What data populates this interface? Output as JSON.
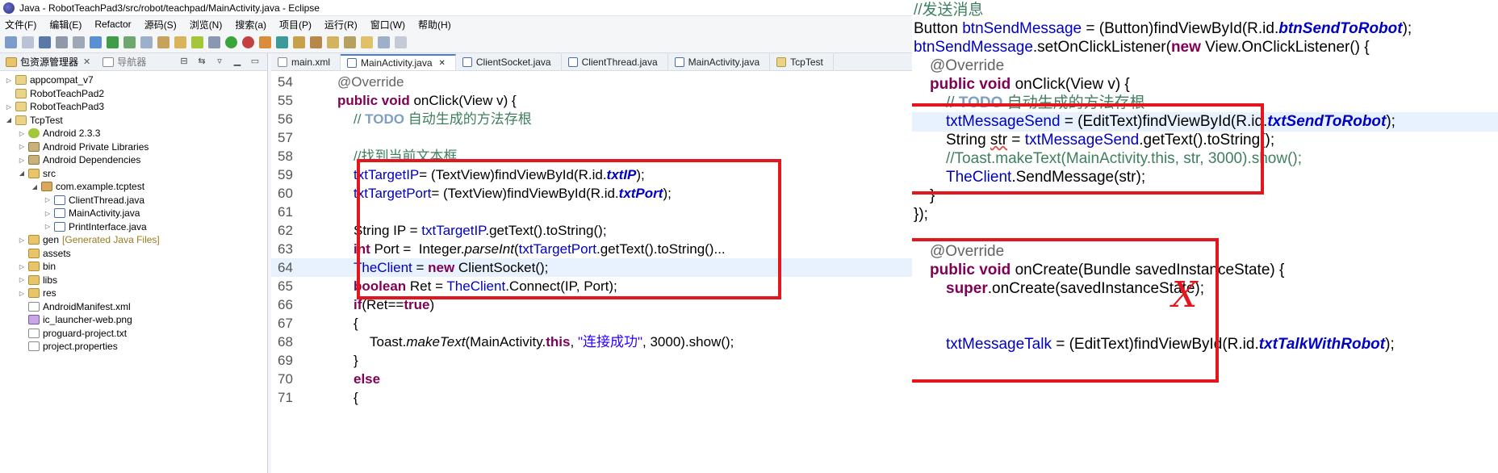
{
  "window": {
    "title": "Java  -  RobotTeachPad3/src/robot/teachpad/MainActivity.java  -  Eclipse"
  },
  "menu": [
    "文件(F)",
    "编辑(E)",
    "Refactor",
    "源码(S)",
    "浏览(N)",
    "搜索(a)",
    "项目(P)",
    "运行(R)",
    "窗口(W)",
    "帮助(H)"
  ],
  "explorer": {
    "tab_label": "包资源管理器",
    "tab2_label": "导航器",
    "tree": [
      {
        "label": "appcompat_v7",
        "depth": 0,
        "twisty": "▷",
        "icon": "project-icon"
      },
      {
        "label": "RobotTeachPad2",
        "depth": 0,
        "twisty": "",
        "icon": "project-icon"
      },
      {
        "label": "RobotTeachPad3",
        "depth": 0,
        "twisty": "▷",
        "icon": "project-icon"
      },
      {
        "label": "TcpTest",
        "depth": 0,
        "twisty": "◢",
        "icon": "project-icon"
      },
      {
        "label": "Android 2.3.3",
        "depth": 1,
        "twisty": "▷",
        "icon": "android-icon"
      },
      {
        "label": "Android Private Libraries",
        "depth": 1,
        "twisty": "▷",
        "icon": "library-icon"
      },
      {
        "label": "Android Dependencies",
        "depth": 1,
        "twisty": "▷",
        "icon": "library-icon"
      },
      {
        "label": "src",
        "depth": 1,
        "twisty": "◢",
        "icon": "source-folder-icon"
      },
      {
        "label": "com.example.tcptest",
        "depth": 2,
        "twisty": "◢",
        "icon": "package-icon"
      },
      {
        "label": "ClientThread.java",
        "depth": 3,
        "twisty": "▷",
        "icon": "java-file-icon"
      },
      {
        "label": "MainActivity.java",
        "depth": 3,
        "twisty": "▷",
        "icon": "java-file-icon"
      },
      {
        "label": "PrintInterface.java",
        "depth": 3,
        "twisty": "▷",
        "icon": "java-file-icon"
      },
      {
        "label": "gen",
        "note": "[Generated Java Files]",
        "depth": 1,
        "twisty": "▷",
        "icon": "source-folder-icon"
      },
      {
        "label": "assets",
        "depth": 1,
        "twisty": "",
        "icon": "folder-icon"
      },
      {
        "label": "bin",
        "depth": 1,
        "twisty": "▷",
        "icon": "folder-icon"
      },
      {
        "label": "libs",
        "depth": 1,
        "twisty": "▷",
        "icon": "folder-icon"
      },
      {
        "label": "res",
        "depth": 1,
        "twisty": "▷",
        "icon": "folder-icon"
      },
      {
        "label": "AndroidManifest.xml",
        "depth": 1,
        "twisty": "",
        "icon": "xml-file-icon"
      },
      {
        "label": "ic_launcher-web.png",
        "depth": 1,
        "twisty": "",
        "icon": "image-file-icon"
      },
      {
        "label": "proguard-project.txt",
        "depth": 1,
        "twisty": "",
        "icon": "text-file-icon"
      },
      {
        "label": "project.properties",
        "depth": 1,
        "twisty": "",
        "icon": "text-file-icon"
      }
    ]
  },
  "editor": {
    "tabs": [
      {
        "label": "main.xml",
        "active": false
      },
      {
        "label": "MainActivity.java",
        "active": true,
        "closable": "✕"
      },
      {
        "label": "ClientSocket.java",
        "active": false
      },
      {
        "label": "ClientThread.java",
        "active": false
      },
      {
        "label": "MainActivity.java",
        "active": false
      },
      {
        "label": "TcpTest",
        "active": false
      }
    ],
    "lines": [
      {
        "n": "54",
        "indent": 1,
        "tokens": [
          [
            "ann",
            "@Override"
          ]
        ]
      },
      {
        "n": "55",
        "indent": 1,
        "tokens": [
          [
            "kw",
            "public"
          ],
          [
            "",
            " "
          ],
          [
            "kw",
            "void"
          ],
          [
            "",
            " onClick(View v) {"
          ]
        ]
      },
      {
        "n": "56",
        "indent": 2,
        "tokens": [
          [
            "cm",
            "// "
          ],
          [
            "todo",
            "TODO"
          ],
          [
            "cm",
            " 自动生成的方法存根"
          ]
        ]
      },
      {
        "n": "57",
        "indent": 0,
        "tokens": []
      },
      {
        "n": "58",
        "indent": 2,
        "tokens": [
          [
            "cm",
            "//找到当前文本框"
          ]
        ]
      },
      {
        "n": "59",
        "indent": 2,
        "tokens": [
          [
            "fld",
            "txtTargetIP"
          ],
          [
            "",
            "= (TextView)findViewById(R.id."
          ],
          [
            "sfld",
            "txtIP"
          ],
          [
            "",
            ");"
          ]
        ]
      },
      {
        "n": "60",
        "indent": 2,
        "tokens": [
          [
            "fld",
            "txtTargetPort"
          ],
          [
            "",
            "= (TextView)findViewById(R.id."
          ],
          [
            "sfld",
            "txtPort"
          ],
          [
            "",
            ");"
          ]
        ]
      },
      {
        "n": "61",
        "indent": 0,
        "tokens": []
      },
      {
        "n": "62",
        "indent": 2,
        "tokens": [
          [
            "",
            "String IP = "
          ],
          [
            "fld",
            "txtTargetIP"
          ],
          [
            "",
            ".getText().toString();"
          ]
        ]
      },
      {
        "n": "63",
        "indent": 2,
        "tokens": [
          [
            "kw",
            "int"
          ],
          [
            "",
            " Port =  Integer."
          ],
          [
            "it",
            "parseInt"
          ],
          [
            "",
            "("
          ],
          [
            "fld",
            "txtTargetPort"
          ],
          [
            "",
            ".getText().toString()..."
          ]
        ]
      },
      {
        "n": "64",
        "indent": 2,
        "current": true,
        "tokens": [
          [
            "fld",
            "TheClient"
          ],
          [
            "",
            " = "
          ],
          [
            "kw",
            "new"
          ],
          [
            "",
            " ClientSocket();"
          ]
        ]
      },
      {
        "n": "65",
        "indent": 2,
        "tokens": [
          [
            "kw",
            "boolean"
          ],
          [
            "",
            " Ret = "
          ],
          [
            "fld",
            "TheClient"
          ],
          [
            "",
            ".Connect(IP, Port);"
          ]
        ]
      },
      {
        "n": "66",
        "indent": 2,
        "tokens": [
          [
            "kw",
            "if"
          ],
          [
            "",
            "(Ret=="
          ],
          [
            "kw",
            "true"
          ],
          [
            "",
            ")"
          ]
        ]
      },
      {
        "n": "67",
        "indent": 2,
        "tokens": [
          [
            "",
            "{"
          ]
        ]
      },
      {
        "n": "68",
        "indent": 3,
        "tokens": [
          [
            "",
            "Toast."
          ],
          [
            "it",
            "makeText"
          ],
          [
            "",
            "(MainActivity."
          ],
          [
            "kw",
            "this"
          ],
          [
            "",
            ", "
          ],
          [
            "str",
            "\"连接成功\""
          ],
          [
            "",
            ", 3000).show();"
          ]
        ]
      },
      {
        "n": "69",
        "indent": 2,
        "tokens": [
          [
            "",
            "}"
          ]
        ]
      },
      {
        "n": "70",
        "indent": 2,
        "tokens": [
          [
            "kw",
            "else"
          ]
        ]
      },
      {
        "n": "71",
        "indent": 2,
        "tokens": [
          [
            "",
            "{"
          ]
        ]
      }
    ]
  },
  "snippet": {
    "lines": [
      {
        "indent": 0,
        "tokens": [
          [
            "cm",
            "//发送消息"
          ]
        ]
      },
      {
        "indent": 0,
        "tokens": [
          [
            "",
            "Button "
          ],
          [
            "fld",
            "btnSendMessage"
          ],
          [
            "",
            " = (Button)findViewById(R.id."
          ],
          [
            "sfld",
            "btnSendToRobot"
          ],
          [
            "",
            ");"
          ]
        ]
      },
      {
        "indent": 0,
        "tokens": [
          [
            "fld",
            "btnSendMessage"
          ],
          [
            "",
            ".setOnClickListener("
          ],
          [
            "kw",
            "new"
          ],
          [
            "",
            " View.OnClickListener() {"
          ]
        ]
      },
      {
        "indent": 1,
        "tokens": [
          [
            "ann",
            "@Override"
          ]
        ]
      },
      {
        "indent": 1,
        "tokens": [
          [
            "kw",
            "public"
          ],
          [
            "",
            " "
          ],
          [
            "kw",
            "void"
          ],
          [
            "",
            " onClick(View v) {"
          ]
        ]
      },
      {
        "indent": 2,
        "tokens": [
          [
            "cm",
            "// "
          ],
          [
            "todo",
            "TODO"
          ],
          [
            "cm",
            " 自动生成的方法存根"
          ]
        ]
      },
      {
        "indent": 2,
        "hl": true,
        "tokens": [
          [
            "fld",
            "txtMessageSend"
          ],
          [
            "",
            " = (EditText)findViewById(R.id."
          ],
          [
            "sfld",
            "txtSendToRobot"
          ],
          [
            "",
            ");"
          ]
        ]
      },
      {
        "indent": 2,
        "tokens": [
          [
            "",
            "String "
          ],
          [
            "sq",
            "str"
          ],
          [
            "",
            " = "
          ],
          [
            "fld",
            "txtMessageSend"
          ],
          [
            "",
            ".getText().toString();"
          ]
        ]
      },
      {
        "indent": 2,
        "tokens": [
          [
            "cm",
            "//Toast.makeText(MainActivity.this, str, 3000).show();"
          ]
        ]
      },
      {
        "indent": 2,
        "tokens": [
          [
            "fld",
            "TheClient"
          ],
          [
            "",
            ".SendMessage(str);"
          ]
        ]
      },
      {
        "indent": 1,
        "tokens": [
          [
            "",
            "}"
          ]
        ]
      },
      {
        "indent": 0,
        "tokens": [
          [
            "",
            "});"
          ]
        ]
      },
      {
        "indent": 0,
        "tokens": []
      },
      {
        "indent": 1,
        "tokens": [
          [
            "ann",
            "@Override"
          ]
        ]
      },
      {
        "indent": 1,
        "tokens": [
          [
            "kw",
            "public"
          ],
          [
            "",
            " "
          ],
          [
            "kw",
            "void"
          ],
          [
            "",
            " onCreate(Bundle savedInstanceState) {"
          ]
        ]
      },
      {
        "indent": 2,
        "tokens": [
          [
            "kw",
            "super"
          ],
          [
            "",
            ".onCreate(savedInstanceState);"
          ]
        ]
      },
      {
        "indent": 0,
        "tokens": []
      },
      {
        "indent": 0,
        "tokens": []
      },
      {
        "indent": 2,
        "tokens": [
          [
            "fld",
            "txtMessageTalk"
          ],
          [
            "",
            " = (EditText)findViewById(R.id."
          ],
          [
            "sfld",
            "txtTalkWithRobot"
          ],
          [
            "",
            ");"
          ]
        ]
      }
    ],
    "mark": "X"
  },
  "colors": {
    "highlight": "#e3161e",
    "keyword": "#7f0055",
    "field": "#0000c0",
    "comment": "#3f7f5f",
    "string": "#2a00ff"
  }
}
